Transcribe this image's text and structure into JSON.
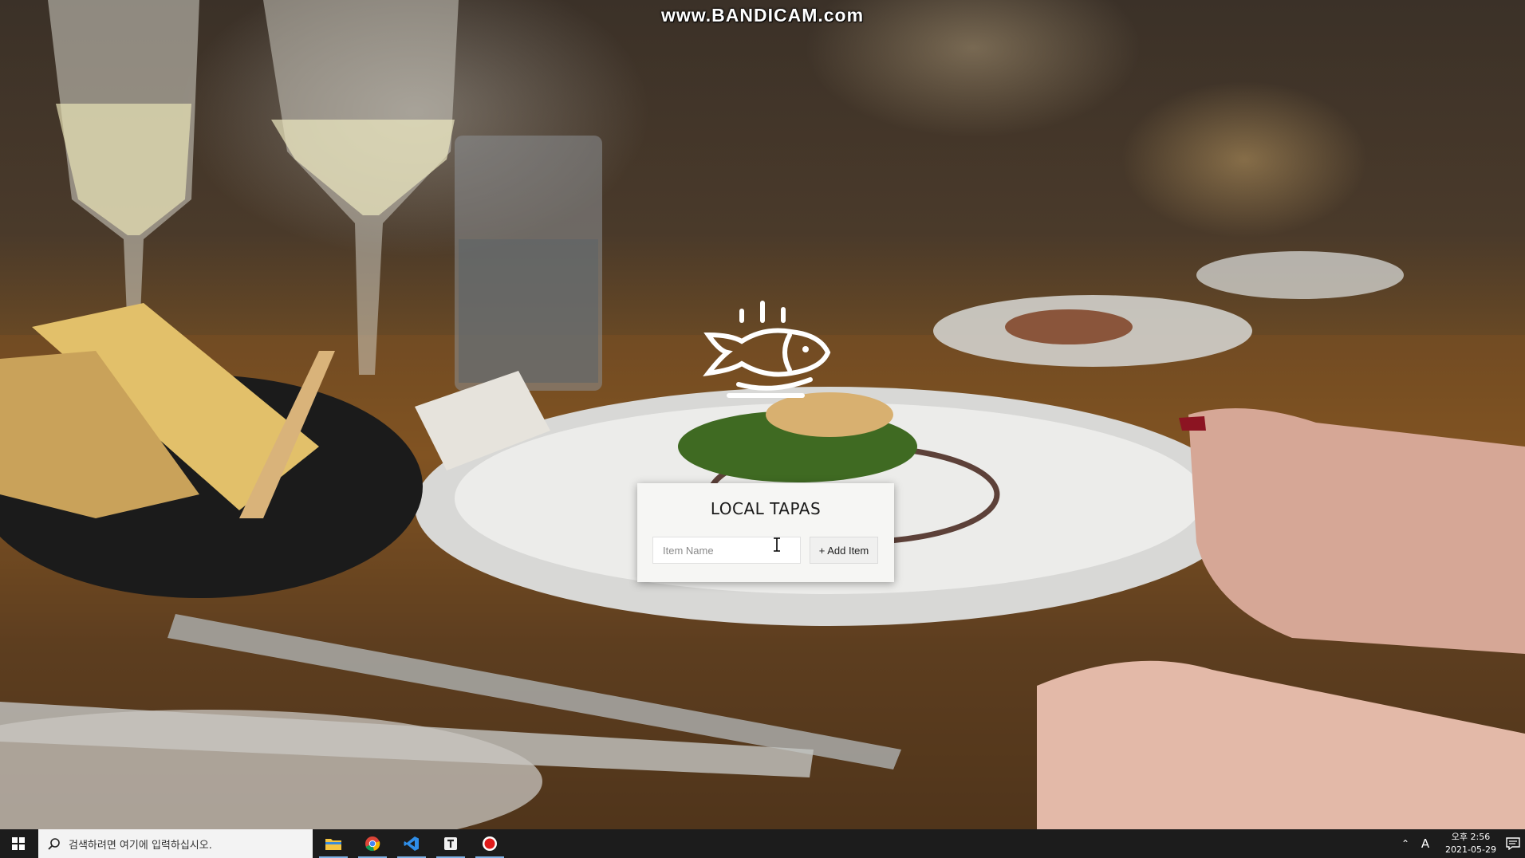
{
  "watermark": "www.BANDICAM.com",
  "app": {
    "logo_icon": "steaming-fish-icon",
    "title": "LOCAL TAPAS",
    "item_input": {
      "placeholder": "Item Name",
      "value": ""
    },
    "add_button_label": "+ Add Item"
  },
  "taskbar": {
    "start_icon": "windows-start-icon",
    "search_placeholder": "검색하려면 여기에 입력하십시오.",
    "apps": [
      {
        "name": "file-explorer-icon",
        "running": true
      },
      {
        "name": "chrome-icon",
        "running": true
      },
      {
        "name": "vscode-icon",
        "running": true
      },
      {
        "name": "typora-icon",
        "running": true
      },
      {
        "name": "bandicam-record-icon",
        "running": true
      }
    ],
    "tray": {
      "ime_indicator": "A",
      "time": "오후 2:56",
      "date": "2021-05-29"
    }
  },
  "colors": {
    "card_background": "#f6f6f4",
    "taskbar_background": "#1c1c1c",
    "search_background": "#f3f3f3"
  }
}
